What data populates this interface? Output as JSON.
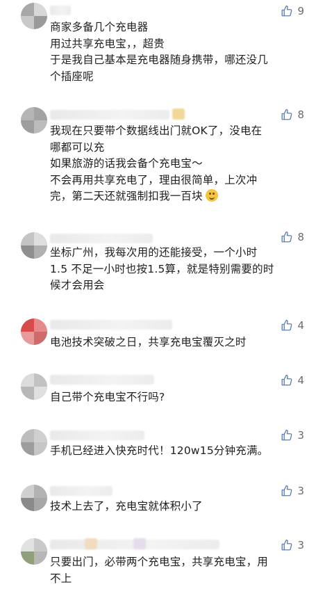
{
  "comments": [
    {
      "likes": "9",
      "lines": [
        "商家多备几个充电器",
        "用过共享充电宝，，超贵",
        "于是我自己基本是充电器随身携带，哪还没几",
        "个插座呢"
      ]
    },
    {
      "likes": "8",
      "lines": [
        "我现在只要带个数据线出门就OK了，没电在",
        "哪都可以充",
        "如果旅游的话我会备个充电宝～",
        "不会再用共享充电了，理由很简单，上次冲",
        "完，第二天还就强制扣我一百块"
      ],
      "emoji": "smiling-face-icon"
    },
    {
      "likes": "8",
      "lines": [
        "坐标广州，我每次用的还能接受，一个小时",
        "1.5 不足一小时也按1.5算，就是特别需要的时",
        "候才会用会"
      ]
    },
    {
      "likes": "4",
      "lines": [
        "电池技术突破之日，共享充电宝覆灭之时"
      ]
    },
    {
      "likes": "4",
      "lines": [
        "自己带个充电宝不行吗?"
      ]
    },
    {
      "likes": "3",
      "lines": [
        "手机已经进入快充时代！120w15分钟充满。"
      ]
    },
    {
      "likes": "3",
      "lines": [
        "技术上去了，充电宝就体积小了"
      ]
    },
    {
      "likes": "3",
      "lines": [
        "只要出门，必带两个充电宝，共享充电宝，用",
        "不上"
      ]
    }
  ],
  "colors": {
    "like_icon": "#5b7fb3",
    "text": "#202020",
    "count": "#6b6b6b"
  },
  "icons": {
    "like": "thumbs-up-icon"
  }
}
